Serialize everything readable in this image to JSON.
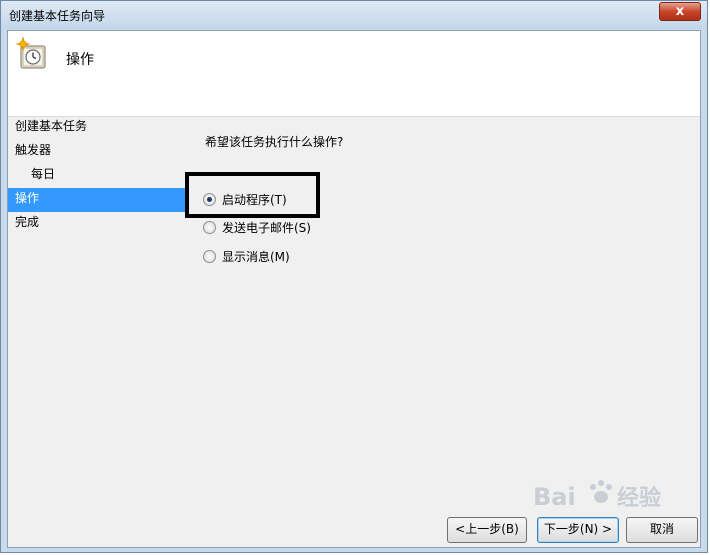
{
  "window": {
    "title": "创建基本任务向导",
    "close_symbol": "x"
  },
  "header": {
    "title": "操作",
    "icon": "scheduled-task-clock-icon"
  },
  "steps": [
    {
      "label": "创建基本任务",
      "active": false,
      "sub": false
    },
    {
      "label": "触发器",
      "active": false,
      "sub": false
    },
    {
      "label": "每日",
      "active": false,
      "sub": true
    },
    {
      "label": "操作",
      "active": true,
      "sub": false
    },
    {
      "label": "完成",
      "active": false,
      "sub": false
    }
  ],
  "content": {
    "question": "希望该任务执行什么操作?",
    "options": [
      {
        "label": "启动程序(T)",
        "checked": true
      },
      {
        "label": "发送电子邮件(S)",
        "checked": false
      },
      {
        "label": "显示消息(M)",
        "checked": false
      }
    ]
  },
  "buttons": {
    "back": "<上一步(B)",
    "next": "下一步(N) >",
    "cancel": "取消"
  },
  "colors": {
    "selection": "#3399ff",
    "annotation_box": "#000000"
  }
}
